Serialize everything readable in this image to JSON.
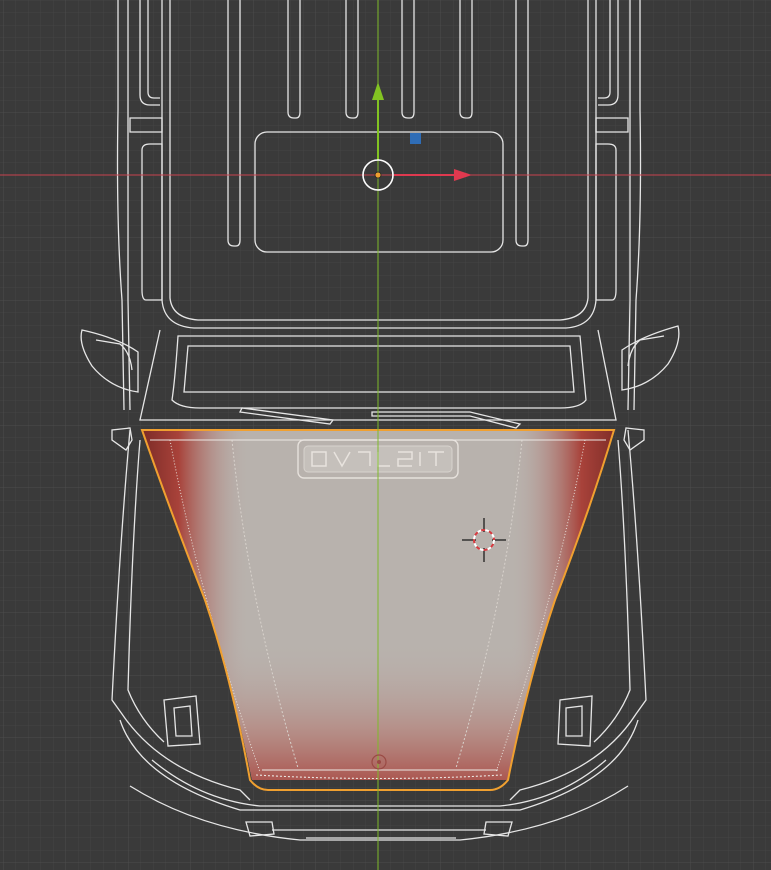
{
  "viewport": {
    "view": "top-orthographic",
    "colors": {
      "background": "#3a3a3a",
      "grid_minor": "#444444",
      "grid_major": "#4d4d4d",
      "x_axis": "#c8424f",
      "y_axis": "#7fba2a",
      "wireframe": "#e8e8e8",
      "selection_outline": "#f0a030",
      "paint_base": "#b8b2ad",
      "paint_red": "#a63a34",
      "gizmo_x": "#e0394f",
      "gizmo_y": "#82c322",
      "gizmo_plane": "#2f6db6"
    },
    "gizmo": {
      "type": "move",
      "handles": [
        "x-axis-arrow",
        "y-axis-arrow",
        "xy-plane-handle",
        "center-circle"
      ]
    },
    "cursor": {
      "type": "3d-cursor"
    },
    "model": {
      "name": "vehicle-top-view",
      "selected_part": "hood",
      "mode": "texture-paint"
    }
  }
}
